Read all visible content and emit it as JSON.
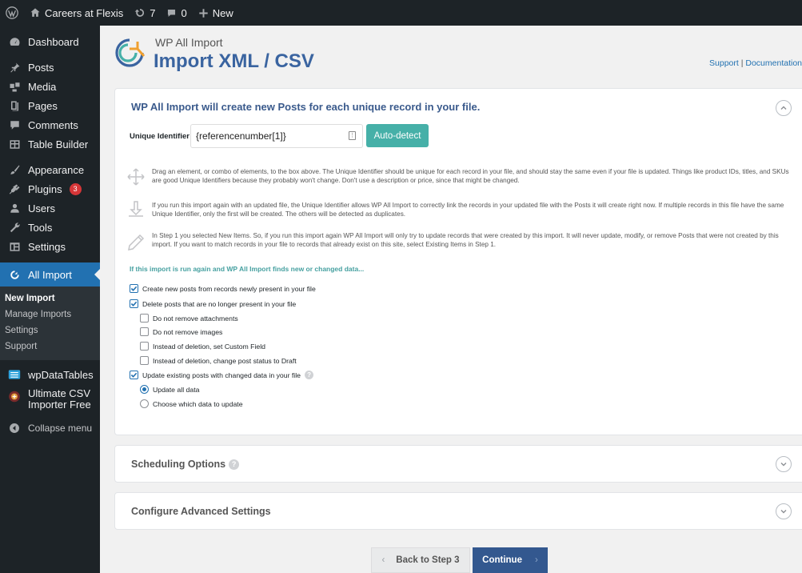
{
  "adminbar": {
    "site_name": "Careers at Flexis",
    "updates_count": "7",
    "comments_count": "0",
    "new_label": "New"
  },
  "sidebar": {
    "items": [
      {
        "label": "Dashboard",
        "icon": "dashboard-icon"
      },
      {
        "label": "Posts",
        "icon": "pin-icon"
      },
      {
        "label": "Media",
        "icon": "media-icon"
      },
      {
        "label": "Pages",
        "icon": "pages-icon"
      },
      {
        "label": "Comments",
        "icon": "comments-icon"
      },
      {
        "label": "Table Builder",
        "icon": "table-icon"
      },
      {
        "label": "Appearance",
        "icon": "brush-icon"
      },
      {
        "label": "Plugins",
        "icon": "plugin-icon",
        "badge": "3"
      },
      {
        "label": "Users",
        "icon": "users-icon"
      },
      {
        "label": "Tools",
        "icon": "wrench-icon"
      },
      {
        "label": "Settings",
        "icon": "settings-icon"
      },
      {
        "label": "All Import",
        "icon": "all-import-icon"
      },
      {
        "label": "wpDataTables",
        "icon": "wpdatatables-icon"
      },
      {
        "label": "Ultimate CSV Importer Free",
        "icon": "csv-importer-icon"
      },
      {
        "label": "Collapse menu",
        "icon": "collapse-icon"
      }
    ],
    "submenu": [
      "New Import",
      "Manage Imports",
      "Settings",
      "Support"
    ]
  },
  "header": {
    "plugin_name": "WP All Import",
    "title": "Import XML / CSV",
    "support": "Support",
    "separator": "|",
    "documentation": "Documentation"
  },
  "panel": {
    "heading": "WP All Import will create new Posts for each unique record in your file.",
    "uid_label": "Unique Identifier",
    "uid_value": "{referencenumber[1]}",
    "autodetect": "Auto-detect",
    "hint1": "Drag an element, or combo of elements, to the box above. The Unique Identifier should be unique for each record in your file, and should stay the same even if your file is updated. Things like product IDs, titles, and SKUs are good Unique Identifiers because they probably won't change. Don't use a description or price, since that might be changed.",
    "hint2": "If you run this import again with an updated file, the Unique Identifier allows WP All Import to correctly link the records in your updated file with the Posts it will create right now. If multiple records in this file have the same Unique Identifier, only the first will be created. The others will be detected as duplicates.",
    "hint3": "In Step 1 you selected New Items. So, if you run this import again WP All Import will only try to update records that were created by this import. It will never update, modify, or remove Posts that were not created by this import. If you want to match records in your file to records that already exist on this site, select Existing Items in Step 1.",
    "question": "If this import is run again and WP All Import finds new or changed data...",
    "options": {
      "create_new": "Create new posts from records newly present in your file",
      "delete_missing": "Delete posts that are no longer present in your file",
      "keep_attachments": "Do not remove attachments",
      "keep_images": "Do not remove images",
      "set_custom_field": "Instead of deletion, set Custom Field",
      "change_to_draft": "Instead of deletion, change post status to Draft",
      "update_existing": "Update existing posts with changed data in your file",
      "update_all": "Update all data",
      "choose_data": "Choose which data to update"
    }
  },
  "scheduling": {
    "title": "Scheduling Options"
  },
  "advanced": {
    "title": "Configure Advanced Settings"
  },
  "footer": {
    "back": "Back to Step 3",
    "continue": "Continue"
  },
  "colors": {
    "accent": "#2271b1",
    "title_blue": "#3a64a0",
    "teal": "#46b0a8",
    "continue_bg": "#33588f"
  }
}
